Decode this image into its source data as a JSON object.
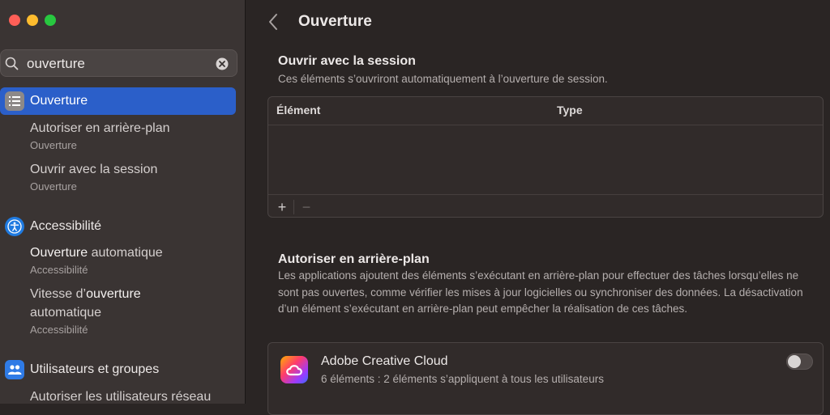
{
  "search": {
    "value": "ouverture"
  },
  "sidebar": {
    "selected": {
      "label": "Ouverture",
      "icon": "list-icon"
    },
    "results": [
      {
        "title": "Autoriser en arrière-plan",
        "section": "Ouverture"
      },
      {
        "title": "Ouvrir avec la session",
        "section": "Ouverture"
      }
    ],
    "accessibility": {
      "label": "Accessibilité",
      "icon": "accessibility-icon",
      "r1_highlight": "Ouverture",
      "r1_rest": " automatique",
      "r1_section": "Accessibilité",
      "r2_prefix": "Vitesse d’",
      "r2_highlight": "ouverture",
      "r2_line2": "automatique",
      "r2_section": "Accessibilité"
    },
    "users": {
      "label": "Utilisateurs et groupes",
      "icon": "users-icon",
      "r1_title": "Autoriser les utilisateurs réseau"
    }
  },
  "main": {
    "title": "Ouverture",
    "session": {
      "title": "Ouvrir avec la session",
      "desc": "Ces éléments s’ouvriront automatiquement à l’ouverture de session.",
      "col_element": "Élément",
      "col_type": "Type",
      "add_label": "+",
      "remove_label": "−"
    },
    "background": {
      "title": "Autoriser en arrière-plan",
      "desc": "Les applications ajoutent des éléments s’exécutant en arrière-plan pour effectuer des tâches lorsqu’elles ne sont pas ouvertes, comme vérifier les mises à jour logicielles ou synchroniser des données. La désactivation d’un élément s’exécutant en arrière-plan peut empêcher la réalisation de ces tâches.",
      "item": {
        "name": "Adobe Creative Cloud",
        "desc": "6 éléments : 2 éléments s’appliquent à tous les utilisateurs",
        "enabled": false
      }
    }
  },
  "colors": {
    "accent": "#2b5fc9",
    "sidebar": "#3a3433",
    "background": "#2a2524"
  }
}
